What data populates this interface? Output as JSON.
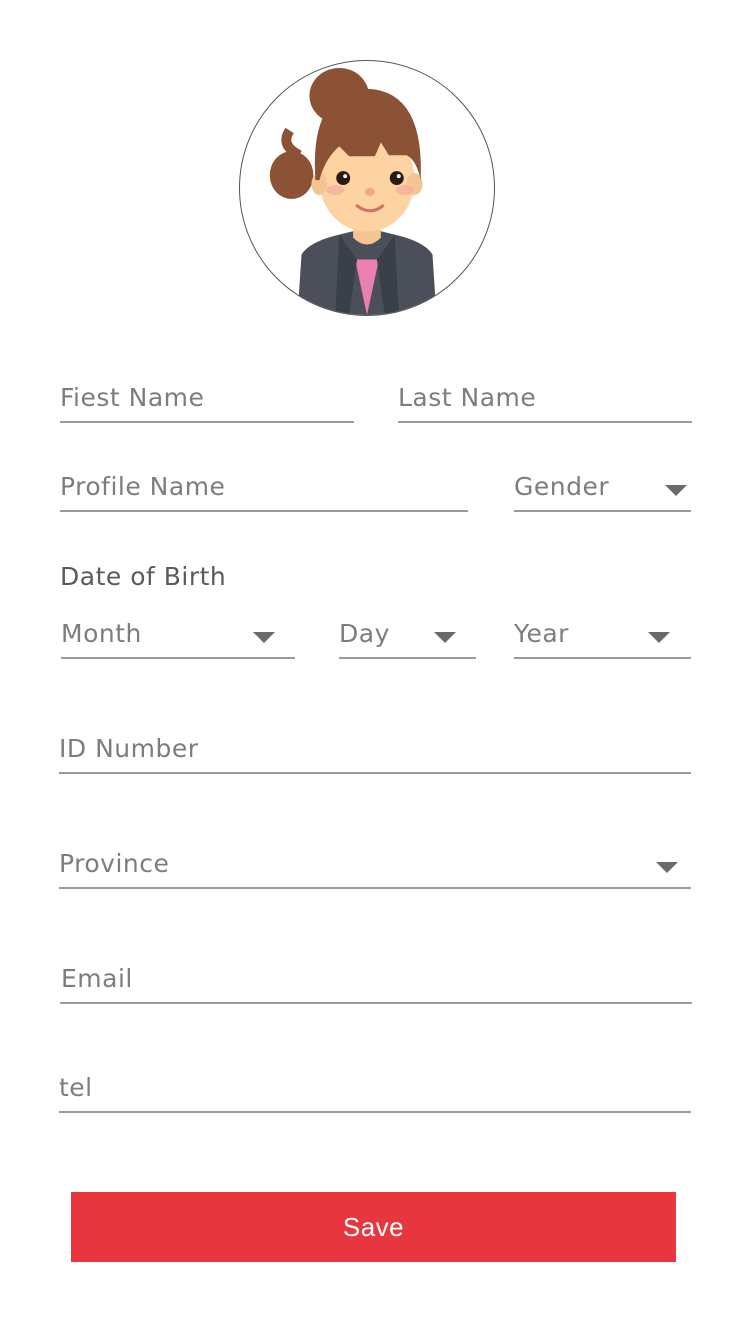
{
  "profile": {
    "avatar_description": "avatar"
  },
  "form": {
    "first_name_placeholder": "Fiest Name",
    "last_name_placeholder": "Last Name",
    "profile_name_placeholder": "Profile Name",
    "gender_placeholder": "Gender",
    "date_of_birth_label": "Date of Birth",
    "month_placeholder": "Month",
    "day_placeholder": "Day",
    "year_placeholder": "Year",
    "id_number_placeholder": "ID Number",
    "province_placeholder": "Province",
    "email_placeholder": "Email",
    "tel_placeholder": "tel"
  },
  "actions": {
    "save_label": "Save"
  },
  "colors": {
    "accent": "#e8363f",
    "placeholder_text": "#7d7d7d",
    "underline": "#9a9a9a"
  },
  "icons": {
    "dropdown": "chevron-down-icon"
  }
}
